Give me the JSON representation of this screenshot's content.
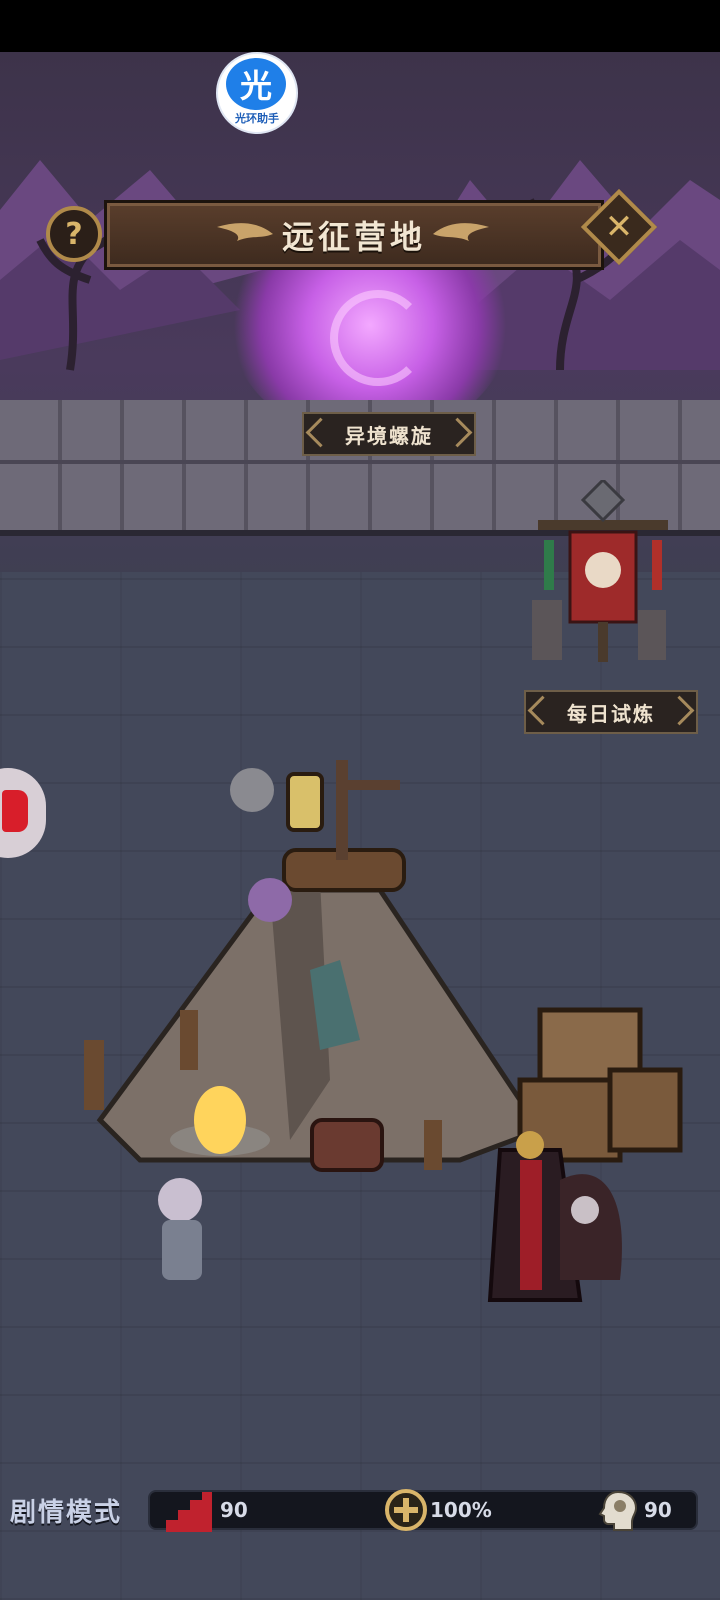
{
  "header": {
    "title": "远征营地",
    "help_symbol": "?",
    "close_symbol": "✕"
  },
  "watermark": {
    "label": "光环助手",
    "glyph": "光"
  },
  "locations": {
    "portal_label": "异境螺旋",
    "daily_trial_label": "每日试炼"
  },
  "bottom": {
    "mode_label": "剧情模式",
    "stairs_value": "90",
    "cross_value": "100%",
    "head_value": "90"
  },
  "icons": {
    "help": "question-icon",
    "close": "close-icon",
    "stairs": "stairs-icon",
    "cross": "crosshair-icon",
    "head": "head-profile-icon"
  },
  "colors": {
    "portal": "#c760e6",
    "banner_red": "#9e2a2a",
    "gold": "#b08a4a"
  }
}
